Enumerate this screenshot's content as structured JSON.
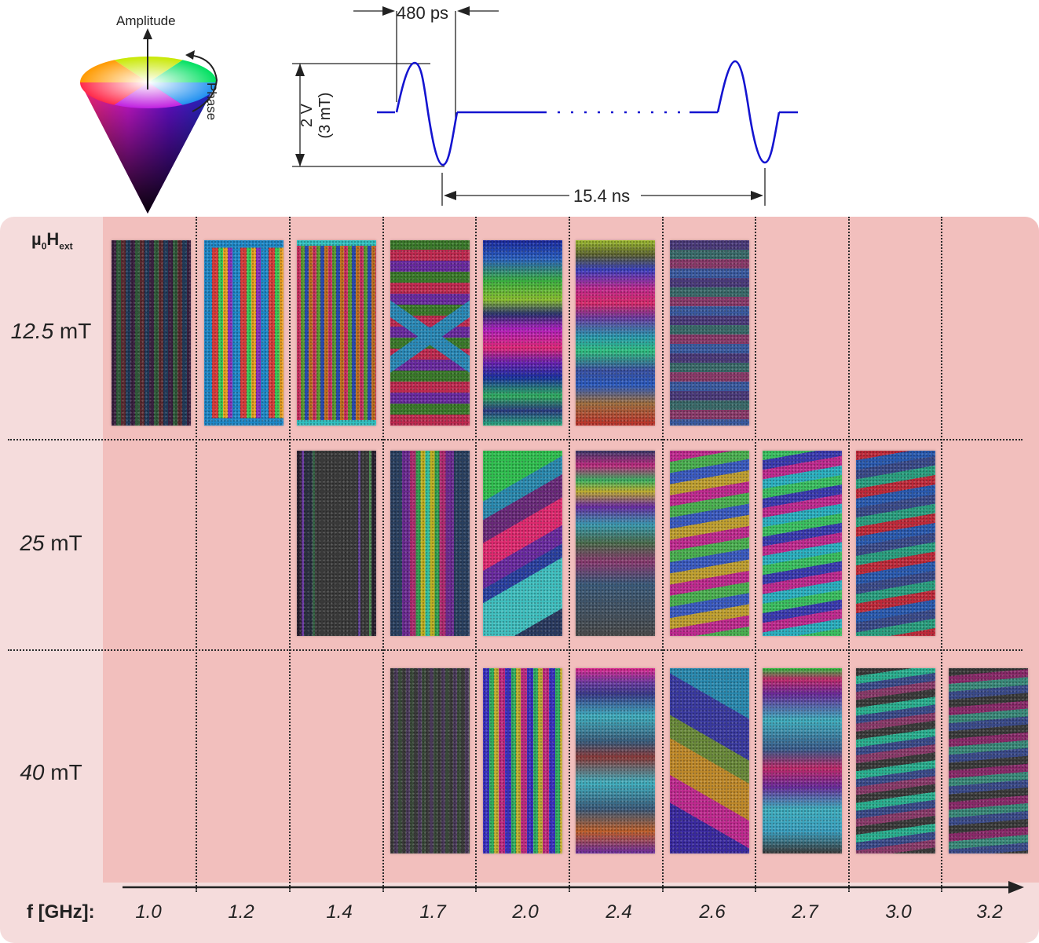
{
  "cone": {
    "amplitude_label": "Amplitude",
    "phase_label": "Phase"
  },
  "pulse": {
    "pulse_width": "480 ps",
    "amplitude_v": "2 V",
    "amplitude_mt": "(3 mT)",
    "period": "15.4 ns"
  },
  "field_label": {
    "mu": "µ",
    "zero": "0",
    "H": "H",
    "sub": "ext"
  },
  "rows": [
    {
      "value": "12.5",
      "unit": " mT"
    },
    {
      "value": "25",
      "unit": " mT"
    },
    {
      "value": "40",
      "unit": " mT"
    }
  ],
  "frequency_label": "f [GHz]:",
  "frequencies": [
    "1.0",
    "1.2",
    "1.4",
    "1.7",
    "2.0",
    "2.4",
    "2.6",
    "2.7",
    "3.0",
    "3.2"
  ]
}
